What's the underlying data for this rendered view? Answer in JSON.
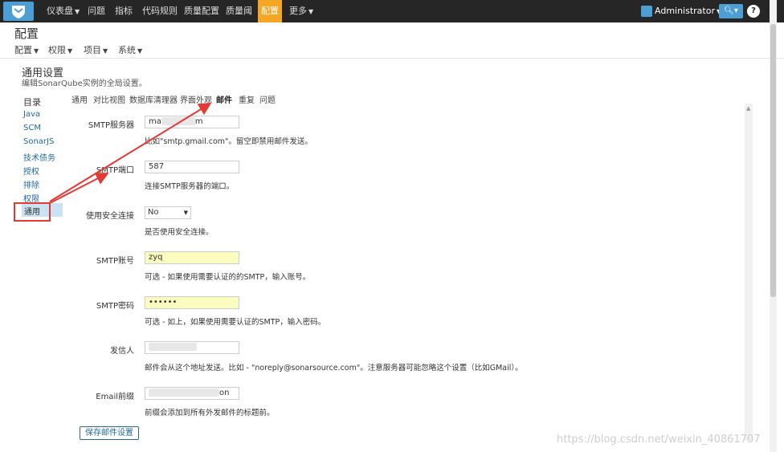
{
  "topbar": {
    "nav": [
      "仪表盘",
      "问题",
      "指标",
      "代码规则",
      "质量配置",
      "质量阈",
      "配置",
      "更多"
    ],
    "user": "Administrator"
  },
  "page": {
    "title": "配置",
    "subnav": [
      "配置",
      "权限",
      "项目",
      "系统"
    ]
  },
  "section": {
    "title": "通用设置",
    "description": "编辑SonarQube实例的全局设置。"
  },
  "categories": {
    "header": "目录",
    "items": [
      "Java",
      "SCM",
      "SonarJS",
      "技术债务",
      "授权",
      "排除",
      "权限"
    ],
    "active": "通用"
  },
  "tabs": [
    "通用",
    "对比视图",
    "数据库清理器",
    "界面外观",
    "邮件",
    "重复",
    "问题"
  ],
  "form": {
    "smtp_host": {
      "label": "SMTP服务器",
      "value_start": "ma",
      "value_end": "m",
      "help": "比如\"smtp.gmail.com\"。留空即禁用邮件发送。"
    },
    "smtp_port": {
      "label": "SMTP端口",
      "value": "587",
      "help": "连接SMTP服务器的端口。"
    },
    "secure": {
      "label": "使用安全连接",
      "value": "No",
      "help": "是否使用安全连接。"
    },
    "smtp_user": {
      "label": "SMTP账号",
      "value": "zyq",
      "help": "可选 - 如果使用需要认证的的SMTP，输入账号。"
    },
    "smtp_password": {
      "label": "SMTP密码",
      "value": "••••••",
      "help": "可选 - 如上，如果使用需要认证的SMTP，输入密码。"
    },
    "from": {
      "label": "发信人",
      "help": "邮件会从这个地址发送。比如 - \"noreply@sonarsource.com\"。注意服务器可能忽略这个设置（比如GMail）。"
    },
    "prefix": {
      "label": "Email前缀",
      "value_end": "on",
      "help": "前缀会添加到所有外发邮件的标题前。"
    },
    "save": "保存邮件设置"
  },
  "watermark": "https://blog.csdn.net/weixin_40861707",
  "colors": {
    "topbar": "#262626",
    "active_nav": "#f5a623",
    "link": "#236a97",
    "highlight": "#e53935"
  }
}
